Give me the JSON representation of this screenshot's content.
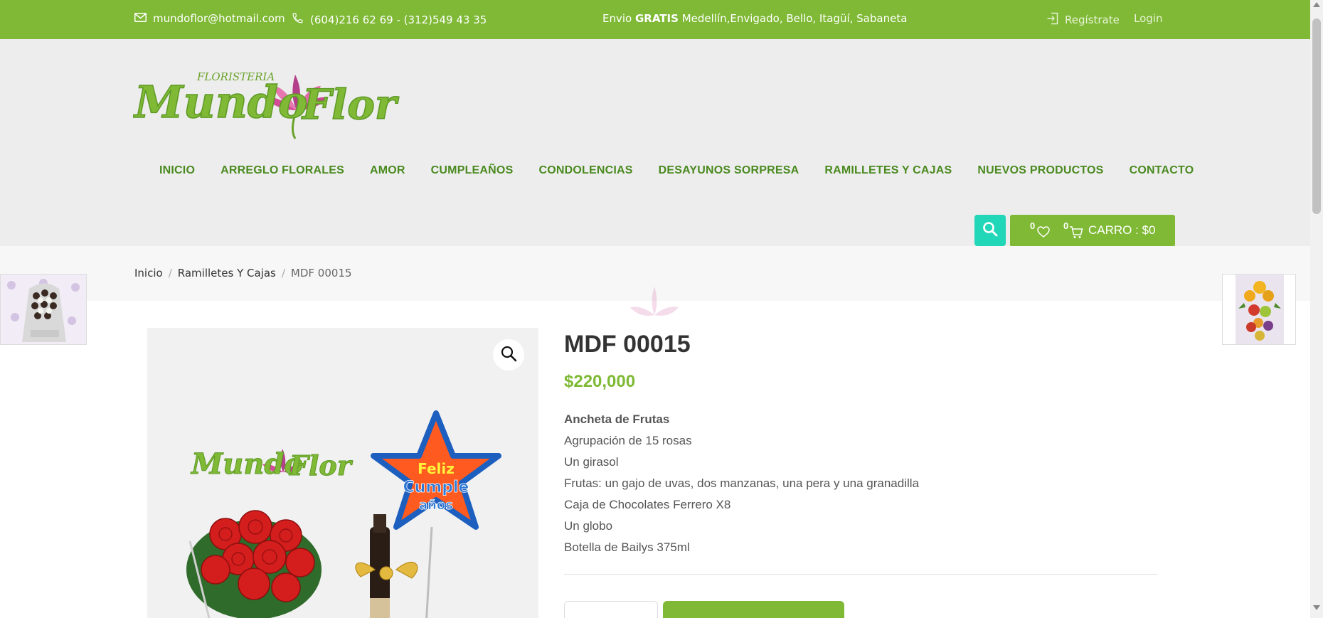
{
  "topbar": {
    "email": "mundoflor@hotmail.com",
    "phone": "(604)216 62 69 - (312)549 43 35",
    "promo_prefix": "Envio ",
    "promo_bold": "GRATIS",
    "promo_suffix": " Medellín,Envigado, Bello, Itagüí, Sabaneta",
    "register": "Regístrate",
    "login": "Login"
  },
  "logo": {
    "small_text": "FLORISTERIA",
    "main_text": "Mundo Flor"
  },
  "nav": {
    "items": [
      "INICIO",
      "ARREGLO FLORALES",
      "AMOR",
      "CUMPLEAÑOS",
      "CONDOLENCIAS",
      "DESAYUNOS SORPRESA",
      "RAMILLETES Y CAJAS",
      "NUEVOS PRODUCTOS",
      "CONTACTO"
    ]
  },
  "cart": {
    "wishlist_count": "0",
    "cart_count": "0",
    "label": "CARRO : $0"
  },
  "breadcrumb": {
    "home": "Inicio",
    "category": "Ramilletes Y Cajas",
    "current": "MDF 00015"
  },
  "product": {
    "title": "MDF 00015",
    "price": "$220,000",
    "description_head": "Ancheta de Frutas",
    "description_lines": [
      "Agrupación de 15 rosas",
      "Un girasol",
      "Frutas: un gajo de uvas, dos manzanas, una pera y una granadilla",
      "Caja de Chocolates Ferrero X8",
      "Un globo",
      "Botella de Bailys 375ml"
    ],
    "image_logo_text": "Mundo Flor",
    "balloon_text": "Feliz Cumple años"
  },
  "colors": {
    "brand_green": "#7fb935",
    "nav_green": "#4a8a1f",
    "search_teal": "#22d6b8"
  },
  "icons": {
    "email": "envelope-icon",
    "phone": "phone-icon",
    "register": "login-arrow-icon",
    "search": "search-icon",
    "wishlist": "heart-icon",
    "cart": "cart-icon",
    "zoom": "magnifier-icon"
  }
}
